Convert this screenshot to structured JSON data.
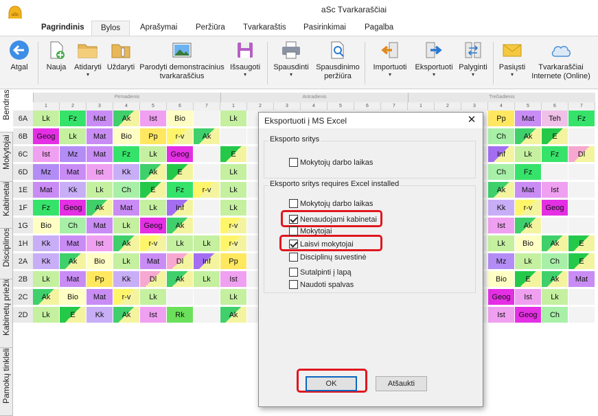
{
  "window": {
    "title": "aSc Tvarkaraščiai"
  },
  "tabs": [
    "Pagrindinis",
    "Bylos",
    "Aprašymai",
    "Peržiūra",
    "Tvarkaraštis",
    "Pasirinkimai",
    "Pagalba"
  ],
  "active_tab": "Bylos",
  "ribbon": {
    "back": "Atgal",
    "new": "Nauja",
    "open": "Atidaryti",
    "close": "Uždaryti",
    "demo": "Parodyti demonstracinius tvarkaraščius",
    "save": "Išsaugoti",
    "print": "Spausdinti",
    "preview": "Spausdinimo peržiūra",
    "import": "Importuoti",
    "export": "Eksportuoti",
    "compare": "Palyginti",
    "send": "Pasiųsti",
    "online": "Tvarkaraščiai Internete (Online)"
  },
  "sidebar": [
    "Bendras",
    "Mokytojai",
    "Kabinetai",
    "Disciplinos",
    "Kabinetų priežiūra",
    "Pamokų tinklelis"
  ],
  "grid": {
    "days": [
      "Pirmadienis",
      "Antradienis",
      "Trečiadienis"
    ],
    "periods": [
      "1",
      "2",
      "3",
      "4",
      "5",
      "6",
      "7"
    ],
    "rows": [
      {
        "class": "6A",
        "mon": [
          "Lk",
          "Fz",
          "Mat",
          "Ak",
          "Ist",
          "Bio",
          ""
        ],
        "tue": [
          "Lk"
        ],
        "wed": [
          "",
          "",
          "",
          "Pp",
          "Mat",
          "Teh",
          "Fz"
        ]
      },
      {
        "class": "6B",
        "mon": [
          "Geog",
          "Lk",
          "Mat",
          "Bio",
          "Pp",
          "r-v",
          "Ak"
        ],
        "tue": [
          ""
        ],
        "wed": [
          "",
          "",
          "",
          "Ch",
          "Ak",
          "E",
          ""
        ]
      },
      {
        "class": "6C",
        "mon": [
          "Ist",
          "Mz",
          "Mat",
          "Fz",
          "Lk",
          "Geog",
          ""
        ],
        "tue": [
          "E"
        ],
        "wed": [
          "",
          "",
          "",
          "Inf",
          "Lk",
          "Fz",
          "Dl"
        ]
      },
      {
        "class": "6D",
        "mon": [
          "Mz",
          "Mat",
          "Ist",
          "Kk",
          "Ak",
          "E",
          ""
        ],
        "tue": [
          "Lk"
        ],
        "wed": [
          "",
          "",
          "",
          "Ch",
          "Fz",
          "",
          ""
        ]
      },
      {
        "class": "1E",
        "mon": [
          "Mat",
          "Kk",
          "Lk",
          "Ch",
          "E",
          "Fz",
          "r-v"
        ],
        "tue": [
          "Lk"
        ],
        "wed": [
          "",
          "",
          "",
          "Ak",
          "Mat",
          "Ist",
          ""
        ]
      },
      {
        "class": "1F",
        "mon": [
          "Fz",
          "Geog",
          "Ak",
          "Mat",
          "Lk",
          "Inf",
          ""
        ],
        "tue": [
          "Lk"
        ],
        "wed": [
          "",
          "",
          "",
          "Kk",
          "r-v",
          "Geog",
          ""
        ]
      },
      {
        "class": "1G",
        "mon": [
          "Bio",
          "Ch",
          "Mat",
          "Lk",
          "Geog",
          "Ak",
          ""
        ],
        "tue": [
          "r-v"
        ],
        "wed": [
          "",
          "",
          "",
          "Ist",
          "Ak",
          "",
          ""
        ]
      },
      {
        "class": "1H",
        "mon": [
          "Kk",
          "Mat",
          "Ist",
          "Ak",
          "r-v",
          "Lk",
          "Lk"
        ],
        "tue": [
          "r-v"
        ],
        "wed": [
          "",
          "",
          "",
          "Lk",
          "Bio",
          "Ak",
          "E"
        ]
      },
      {
        "class": "2A",
        "mon": [
          "Kk",
          "Ak",
          "Bio",
          "Lk",
          "Mat",
          "Dl",
          "Inf"
        ],
        "tue": [
          "Pp"
        ],
        "wed": [
          "",
          "",
          "",
          "Mz",
          "Lk",
          "Ch",
          "E"
        ]
      },
      {
        "class": "2B",
        "mon": [
          "Lk",
          "Mat",
          "Pp",
          "Kk",
          "Dl",
          "Ak",
          "Lk"
        ],
        "tue": [
          "Ist"
        ],
        "wed": [
          "",
          "",
          "",
          "Bio",
          "E",
          "Ak",
          "Mat"
        ]
      },
      {
        "class": "2C",
        "mon": [
          "Ak",
          "Bio",
          "Mat",
          "r-v",
          "Lk",
          "",
          ""
        ],
        "tue": [
          "Lk"
        ],
        "wed": [
          "",
          "",
          "",
          "Geog",
          "Ist",
          "Lk",
          ""
        ]
      },
      {
        "class": "2D",
        "mon": [
          "Lk",
          "E",
          "Kk",
          "Ak",
          "Ist",
          "Rk",
          ""
        ],
        "tue": [
          "Ak"
        ],
        "wed": [
          "",
          "",
          "",
          "Ist",
          "Geog",
          "Ch",
          ""
        ]
      }
    ]
  },
  "dialog": {
    "title": "Eksportuoti į MS Excel",
    "close_glyph": "✕",
    "group1_title": "Eksporto sritys",
    "group1_items": [
      {
        "label": "Mokytojų darbo laikas",
        "checked": false
      }
    ],
    "group2_title": "Eksporto sritys requires Excel installed",
    "group2_items": [
      {
        "label": "Mokytojų darbo laikas",
        "checked": false
      },
      {
        "label": "Nenaudojami kabinetai",
        "checked": true
      },
      {
        "label": "Mokytojai",
        "checked": false
      },
      {
        "label": "Laisvi mokytojai",
        "checked": true
      },
      {
        "label": "Disciplinų suvestinė",
        "checked": false
      },
      {
        "label": "Sutalpinti į lapą",
        "checked": false
      },
      {
        "label": "Naudoti spalvas",
        "checked": false
      }
    ],
    "ok": "OK",
    "cancel": "Atšaukti"
  },
  "colors": {
    "accent": "#0a66c2",
    "highlight": "#e0161e",
    "Lk": "#c4f0a0",
    "Fz": "#36e36a",
    "Mat": "#c98cf5",
    "Ak": "#3fd06b",
    "Ist": "#f0a0f0",
    "Bio": "#fffec4",
    "Geog": "#e42fe4",
    "Pp": "#ffe860",
    "r-v": "#fff56b",
    "Mz": "#b38df5",
    "Kk": "#c8aef7",
    "E": "#25c94a",
    "Ch": "#a8f0a8",
    "Inf": "#a46ef2",
    "Dl": "#f7a8d0",
    "Rk": "#6be05a",
    "Teh": "#f0c0e8"
  }
}
